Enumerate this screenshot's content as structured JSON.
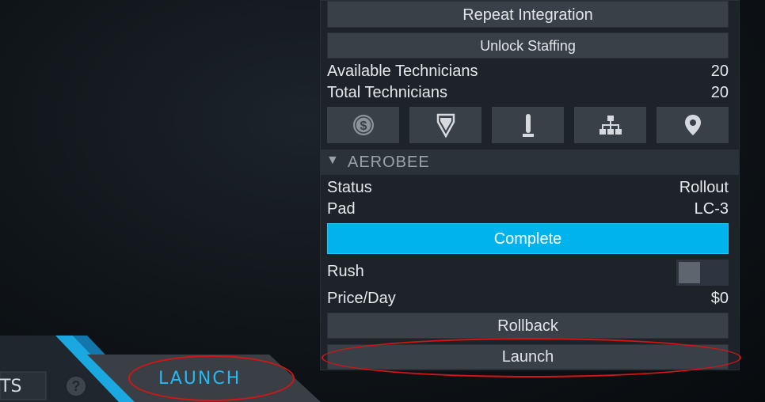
{
  "panel": {
    "repeat_integration_label": "Repeat Integration",
    "unlock_staffing_label": "Unlock Staffing",
    "available_technicians_label": "Available Technicians",
    "available_technicians_value": "20",
    "total_technicians_label": "Total Technicians",
    "total_technicians_value": "20",
    "icons": [
      "dollar-coin-icon",
      "shield-chevron-icon",
      "rocket-stand-icon",
      "hierarchy-icon",
      "location-pin-icon"
    ]
  },
  "vessel": {
    "section_arrow": "▼",
    "name": "AEROBEE",
    "status_label": "Status",
    "status_value": "Rollout",
    "pad_label": "Pad",
    "pad_value": "LC-3",
    "progress_label": "Complete",
    "rush_label": "Rush",
    "price_label": "Price/Day",
    "price_value": "$0",
    "rollback_label": "Rollback",
    "launch_label": "Launch"
  },
  "bottom": {
    "partial_tab_text": "TS",
    "help_symbol": "?",
    "launch_tab_label": "LAUNCH"
  },
  "colors": {
    "accent": "#00b3ec",
    "annotation": "#d61414",
    "panel_bg": "#1e2329",
    "button_bg": "#3a4048"
  }
}
